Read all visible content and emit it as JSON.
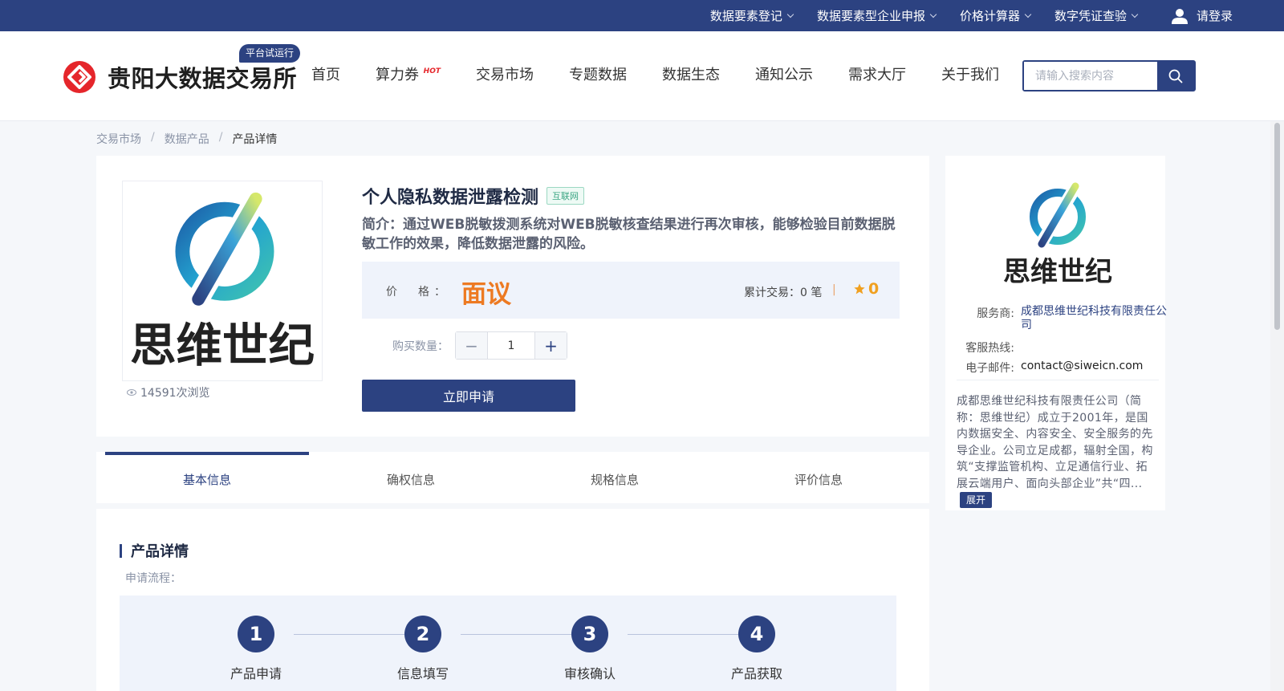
{
  "topbar": {
    "menu": [
      "数据要素登记",
      "数据要素型企业申报",
      "价格计算器",
      "数字凭证查验"
    ],
    "login_label": "请登录"
  },
  "header": {
    "logo_text": "贵阳大数据交易所",
    "beta_badge": "平台试运行",
    "nav": [
      "首页",
      "算力券",
      "交易市场",
      "专题数据",
      "数据生态",
      "通知公示",
      "需求大厅",
      "关于我们"
    ],
    "hot_badge": "HOT",
    "search_placeholder": "请输入搜索内容"
  },
  "breadcrumb": [
    "交易市场",
    "数据产品",
    "产品详情"
  ],
  "breadcrumb_sep": "/",
  "product": {
    "title": "个人隐私数据泄露检测",
    "tag": "互联网",
    "description": "简介：通过WEB脱敏拨测系统对WEB脱敏核查结果进行再次审核，能够检验目前数据脱敏工作的效果，降低数据泄露的风险。",
    "price_label": "价　格：",
    "price_value": "面议",
    "trade_count": "累计交易：0 笔",
    "rating": "0",
    "quantity_label": "购买数量：",
    "quantity": "1",
    "apply_button": "立即申请",
    "views": "14591次浏览",
    "logo_caption": "思维世纪"
  },
  "tabs": [
    "基本信息",
    "确权信息",
    "规格信息",
    "评价信息"
  ],
  "detail": {
    "title": "产品详情",
    "flow_label": "申请流程：",
    "steps": [
      {
        "num": "1",
        "label": "产品申请"
      },
      {
        "num": "2",
        "label": "信息填写"
      },
      {
        "num": "3",
        "label": "审核确认"
      },
      {
        "num": "4",
        "label": "产品获取"
      }
    ]
  },
  "vendor": {
    "logo_caption": "思维世纪",
    "provider_label": "服务商:",
    "provider_value": "成都思维世纪科技有限责任公司",
    "hotline_label": "客服热线:",
    "hotline_value": "",
    "email_label": "电子邮件:",
    "email_value": "contact@siweicn.com",
    "description": "成都思维世纪科技有限责任公司（简称：思维世纪）成立于2001年，是国内数据安全、内容安全、安全服务的先导企业。公司立足成都，辐射全国，构筑“支撑监管机构、立足通信行业、拓展云端用户、面向头部企业”共“四...",
    "expand_label": "展开"
  },
  "colors": {
    "primary": "#2c4281",
    "price": "#ed7a22",
    "star": "#f0a020",
    "tag_green": "#3ca684",
    "logo_red": "#e5262b"
  },
  "icons": [
    "chevron-down-icon",
    "user-icon",
    "search-icon",
    "eye-icon",
    "star-icon",
    "logo-mark-icon"
  ]
}
